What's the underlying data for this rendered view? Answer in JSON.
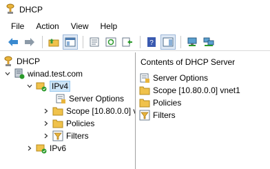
{
  "window": {
    "title": "DHCP",
    "icon": "dhcp-app-icon"
  },
  "menu": [
    "File",
    "Action",
    "View",
    "Help"
  ],
  "toolbar": {
    "buttons": [
      "back-icon",
      "forward-icon",
      "up-folder-icon",
      "show-hide-tree-icon",
      "properties-icon",
      "refresh-icon",
      "export-list-icon",
      "help-icon",
      "action-pane-icon",
      "computer-monitor-icon",
      "network-computers-icon"
    ]
  },
  "tree": {
    "root": "DHCP",
    "server": "winad.test.com",
    "ipv4": "IPv4",
    "server_options": "Server Options",
    "scope": "Scope [10.80.0.0] v",
    "policies": "Policies",
    "filters": "Filters",
    "ipv6": "IPv6"
  },
  "details": {
    "header": "Contents of DHCP Server",
    "items": [
      "Server Options",
      "Scope [10.80.0.0] vnet1",
      "Policies",
      "Filters"
    ]
  },
  "colors": {
    "selection": "#cce4f7",
    "accent": "#0078d7"
  }
}
